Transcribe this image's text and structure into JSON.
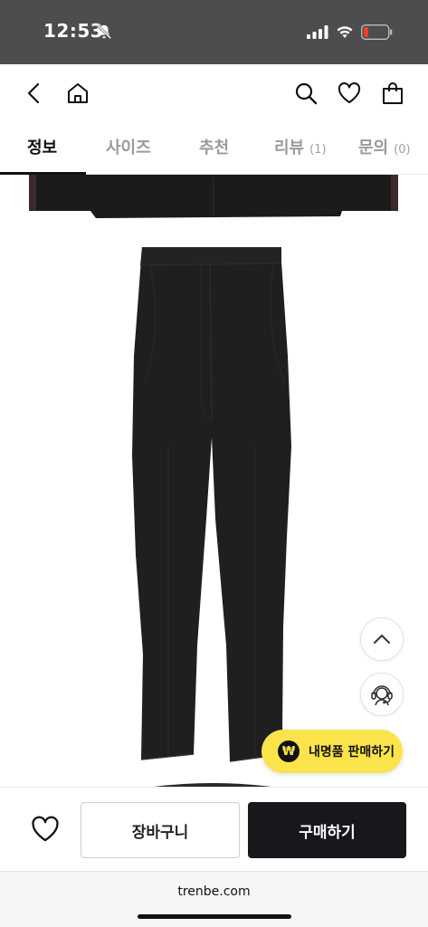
{
  "status_bar": {
    "time": "12:53",
    "icons": [
      "bell-slash-icon",
      "signal-icon",
      "wifi-icon",
      "battery-icon"
    ],
    "battery_color": "#ff3b30"
  },
  "nav": {
    "icons": [
      "back-icon",
      "home-icon",
      "search-icon",
      "heart-icon",
      "shopping-bag-icon"
    ]
  },
  "tabs": [
    {
      "label": "정보",
      "count": "",
      "active": true
    },
    {
      "label": "사이즈",
      "count": ""
    },
    {
      "label": "추천",
      "count": ""
    },
    {
      "label": "리뷰",
      "count": "(1)"
    },
    {
      "label": "문의",
      "count": "(0)"
    }
  ],
  "product": {
    "image": "charcoal-trousers-product-photo",
    "garment_color": "#1f1f1f"
  },
  "floating": {
    "scroll_top_icon": "chevron-up-icon",
    "support_icon": "headset-agent-icon",
    "sell_symbol": "₩",
    "sell_label": "내명품 판매하기",
    "sell_color": "#fbe44b"
  },
  "bottom_bar": {
    "wish_icon": "heart-outline-icon",
    "cart_label": "장바구니",
    "buy_label": "구매하기",
    "buy_color": "#16181b"
  },
  "browser": {
    "url": "trenbe.com"
  }
}
